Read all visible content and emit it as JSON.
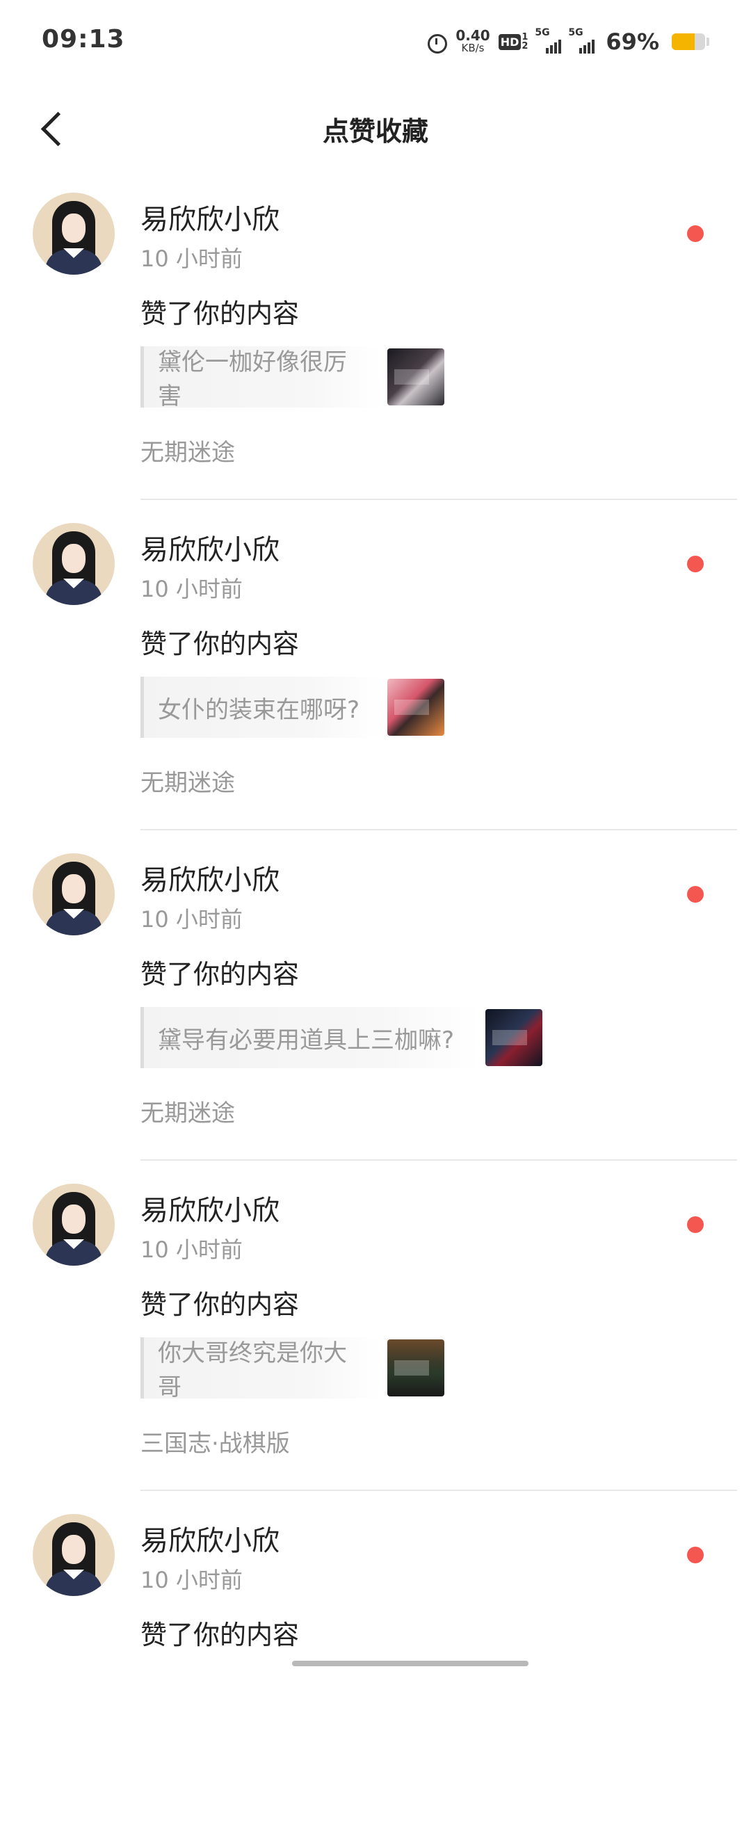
{
  "status_bar": {
    "time": "09:13",
    "speed_value": "0.40",
    "speed_unit": "KB/s",
    "hd": "HD",
    "hd_nums": [
      "1",
      "2"
    ],
    "signal_labels": [
      "5G",
      "5G"
    ],
    "battery_percent": "69%",
    "battery_level": 0.69,
    "battery_color": "#f5b400"
  },
  "header": {
    "title": "点赞收藏",
    "back_icon": "chevron-left-icon"
  },
  "items": [
    {
      "username": "易欣欣小欣",
      "time": "10 小时前",
      "action": "赞了你的内容",
      "quote": "黛伦一枷好像很厉害",
      "source": "无期迷途"
    },
    {
      "username": "易欣欣小欣",
      "time": "10 小时前",
      "action": "赞了你的内容",
      "quote": "女仆的装束在哪呀?",
      "source": "无期迷途"
    },
    {
      "username": "易欣欣小欣",
      "time": "10 小时前",
      "action": "赞了你的内容",
      "quote": "黛导有必要用道具上三枷嘛?",
      "source": "无期迷途"
    },
    {
      "username": "易欣欣小欣",
      "time": "10 小时前",
      "action": "赞了你的内容",
      "quote": "你大哥终究是你大哥",
      "source": "三国志·战棋版"
    },
    {
      "username": "易欣欣小欣",
      "time": "10 小时前",
      "action": "赞了你的内容",
      "quote": "",
      "source": ""
    }
  ],
  "colors": {
    "unread_dot": "#f4574f",
    "secondary_text": "#999999",
    "primary_text": "#222222"
  }
}
